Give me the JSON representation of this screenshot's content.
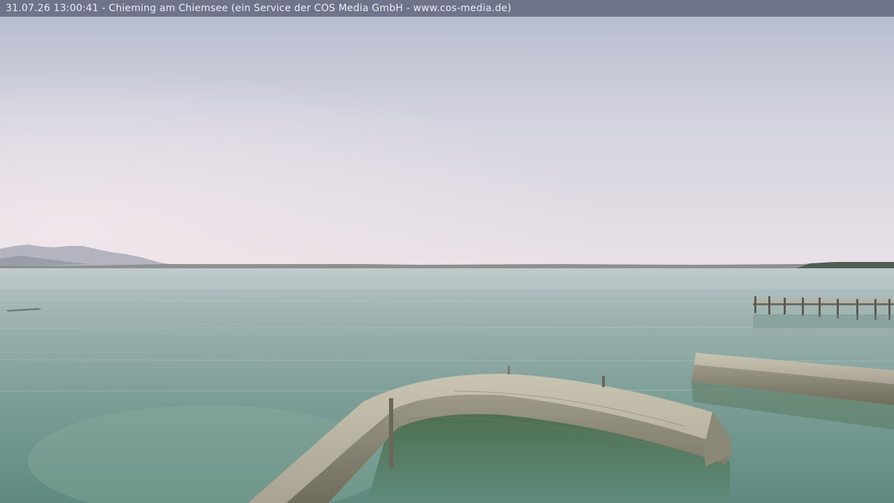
{
  "webcam": {
    "caption": "31.07.26 13:00:41 - Chieming am Chiemsee (ein Service der COS Media GmbH - www.cos-media.de)"
  }
}
